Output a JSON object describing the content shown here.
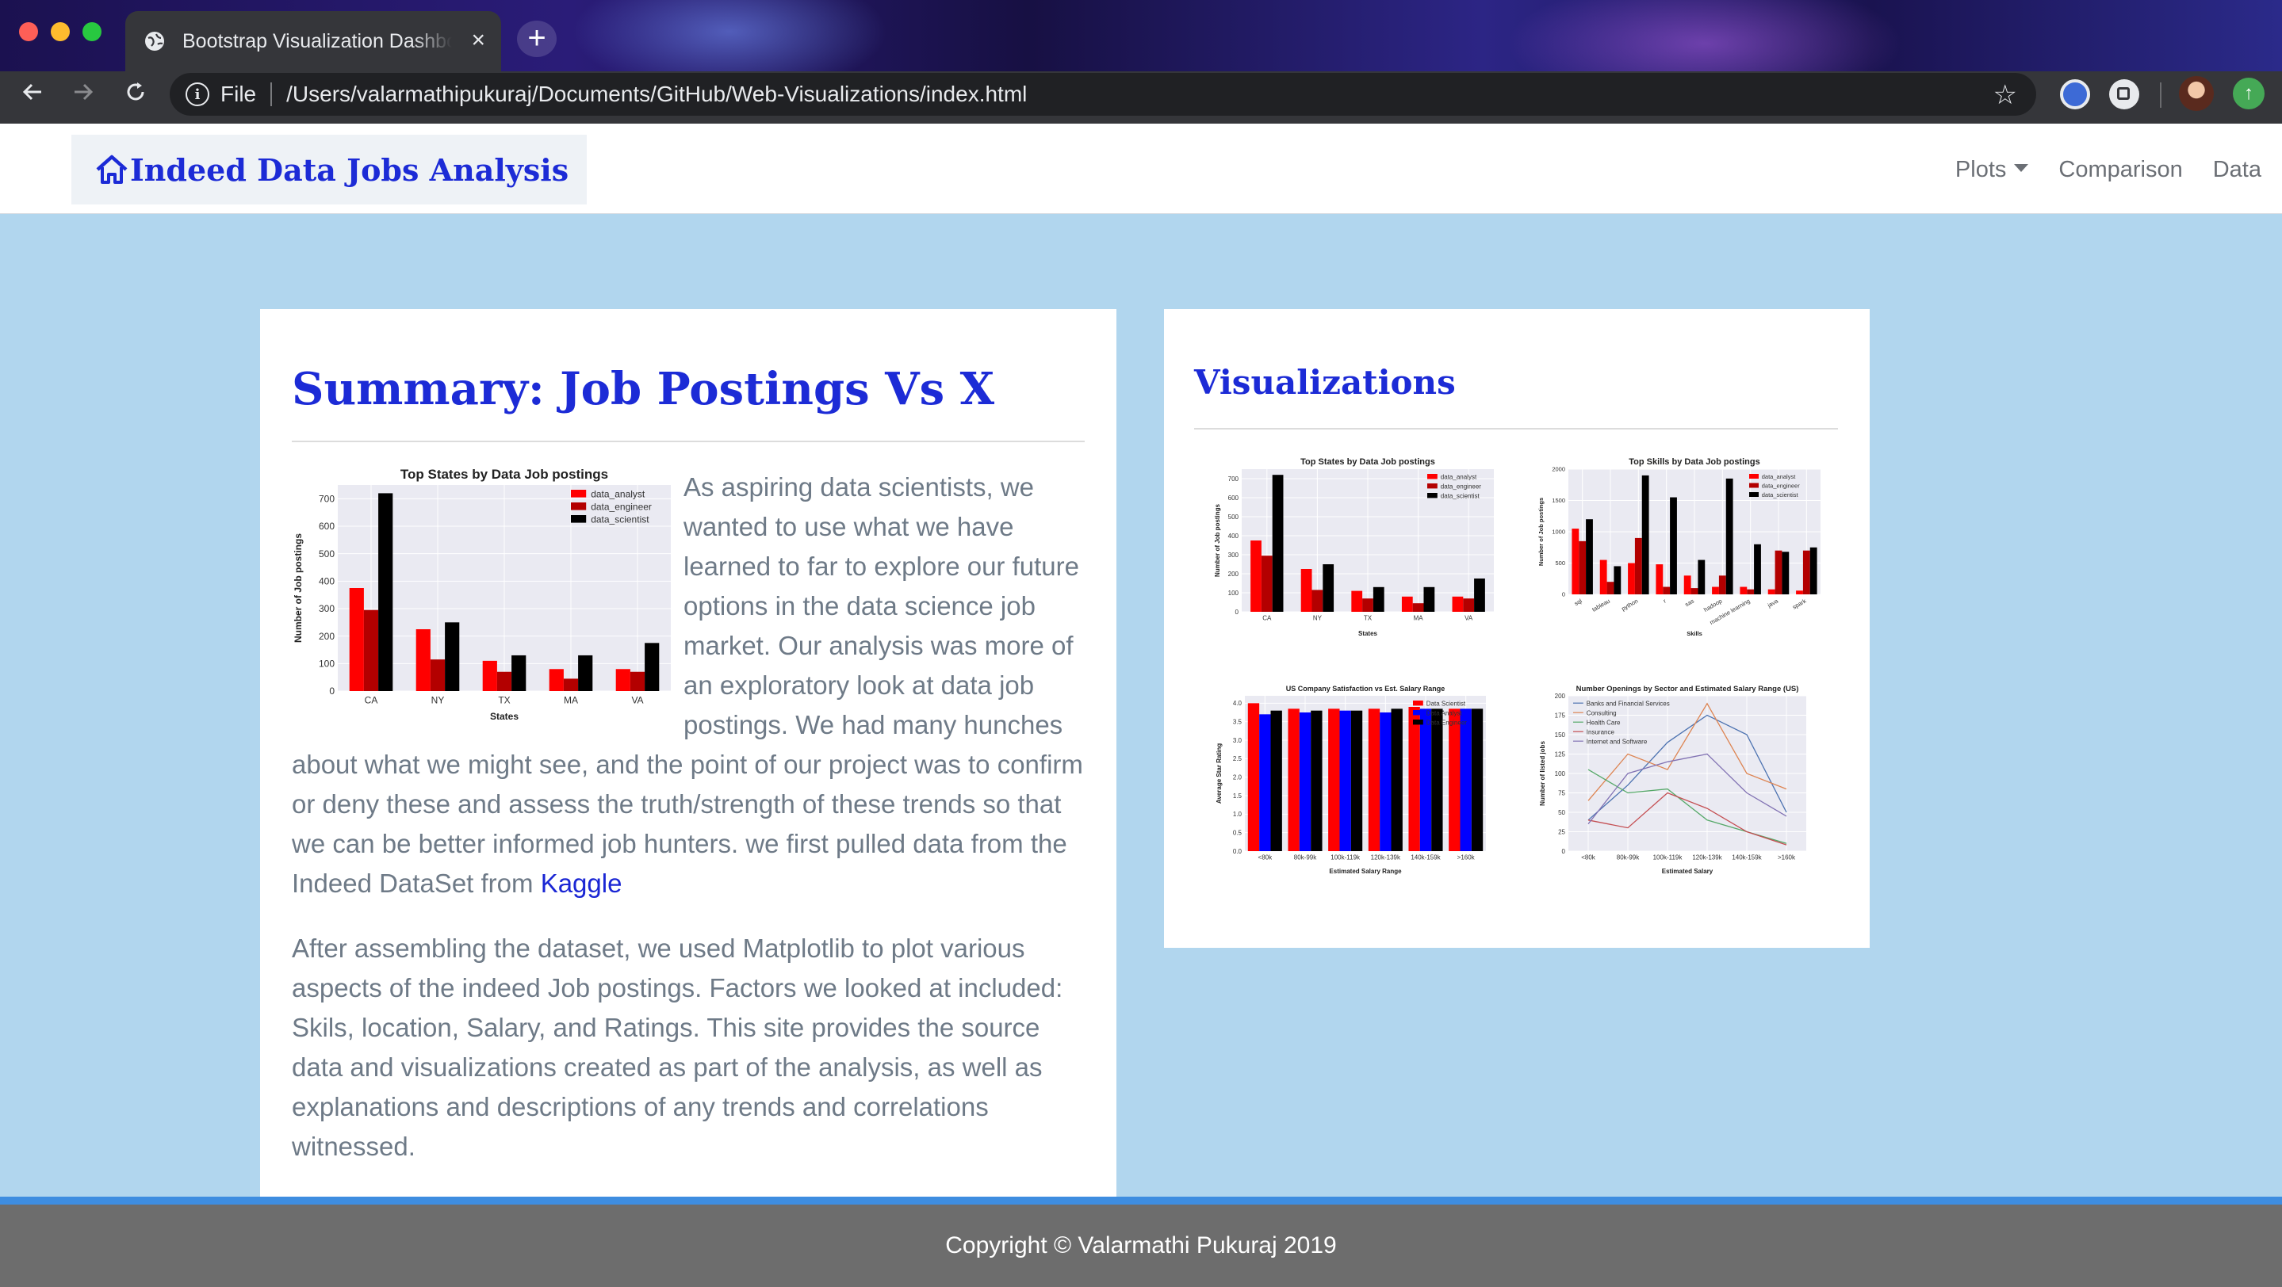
{
  "browser": {
    "tab_title": "Bootstrap Visualization Dashboard",
    "close_glyph": "×",
    "new_tab_glyph": "+",
    "scheme_label": "File",
    "url": "/Users/valarmathipukuraj/Documents/GitHub/Web-Visualizations/index.html",
    "icons": [
      "globe-icon",
      "back-arrow-icon",
      "forward-arrow-icon",
      "reload-icon",
      "info-icon",
      "star-icon",
      "extension-icon",
      "avatar",
      "update-icon"
    ]
  },
  "navbar": {
    "brand": "Indeed Data Jobs Analysis",
    "brand_icon": "home-icon",
    "links": [
      "Plots",
      "Comparison",
      "Data"
    ]
  },
  "summary": {
    "title": "Summary: Job Postings Vs X",
    "p1": "As aspiring data scientists, we wanted to use what we have learned to far to explore our future options in the data science job market. Our analysis was more of an exploratory look at data job postings. We had many hunches about what we might see, and the point of our project was to confirm or deny these and assess the truth/strength of these trends so that we can be better informed job hunters. we first pulled data from the Indeed DataSet from",
    "link": "Kaggle",
    "p2": "After assembling the dataset, we used Matplotlib to plot various aspects of the indeed Job postings. Factors we looked at included: Skils, location, Salary, and Ratings. This site provides the source data and visualizations created as part of the analysis, as well as explanations and descriptions of any trends and correlations witnessed."
  },
  "visualizations": {
    "title": "Visualizations"
  },
  "footer": {
    "text": "Copyright © Valarmathi Pukuraj 2019"
  },
  "colors": {
    "accent": "#1c2bd6",
    "page_bg": "#b1d6ee",
    "footer_bg": "#6d6d6d",
    "footer_accent": "#3e8de0"
  },
  "chart_data": [
    {
      "type": "bar",
      "title": "Top States by Data Job postings",
      "xlabel": "States",
      "ylabel": "Number of Job postings",
      "categories": [
        "CA",
        "NY",
        "TX",
        "MA",
        "VA"
      ],
      "ylim": [
        0,
        750
      ],
      "yticks": [
        0,
        100,
        200,
        300,
        400,
        500,
        600,
        700
      ],
      "series": [
        {
          "name": "data_analyst",
          "color": "#ff0000",
          "values": [
            375,
            225,
            110,
            80,
            80
          ]
        },
        {
          "name": "data_engineer",
          "color": "#b30000",
          "values": [
            295,
            115,
            70,
            45,
            70
          ]
        },
        {
          "name": "data_scientist",
          "color": "#000000",
          "values": [
            720,
            250,
            130,
            130,
            175
          ]
        }
      ],
      "legend": "top-right",
      "grid": true
    },
    {
      "type": "bar",
      "title": "Top States by Data Job postings",
      "xlabel": "States",
      "ylabel": "Number of Job postings",
      "categories": [
        "CA",
        "NY",
        "TX",
        "MA",
        "VA"
      ],
      "ylim": [
        0,
        750
      ],
      "yticks": [
        0,
        100,
        200,
        300,
        400,
        500,
        600,
        700
      ],
      "series": [
        {
          "name": "data_analyst",
          "color": "#ff0000",
          "values": [
            375,
            225,
            110,
            80,
            80
          ]
        },
        {
          "name": "data_engineer",
          "color": "#b30000",
          "values": [
            295,
            115,
            70,
            45,
            70
          ]
        },
        {
          "name": "data_scientist",
          "color": "#000000",
          "values": [
            720,
            250,
            130,
            130,
            175
          ]
        }
      ],
      "legend": "top-right",
      "grid": true
    },
    {
      "type": "bar",
      "title": "Top Skills by Data Job postings",
      "xlabel": "Skills",
      "ylabel": "Number of Job postings",
      "categories": [
        "sql",
        "tableau",
        "python",
        "r",
        "sas",
        "hadoop",
        "machine learning",
        "java",
        "spark"
      ],
      "ylim": [
        0,
        2000
      ],
      "yticks": [
        0,
        500,
        1000,
        1500,
        2000
      ],
      "series": [
        {
          "name": "data_analyst",
          "color": "#ff0000",
          "values": [
            1050,
            550,
            500,
            480,
            300,
            120,
            120,
            80,
            60
          ]
        },
        {
          "name": "data_engineer",
          "color": "#b30000",
          "values": [
            850,
            200,
            900,
            120,
            100,
            300,
            80,
            700,
            700
          ]
        },
        {
          "name": "data_scientist",
          "color": "#000000",
          "values": [
            1200,
            450,
            1900,
            1550,
            550,
            1850,
            800,
            680,
            750
          ]
        }
      ],
      "legend": "top-right",
      "grid": true
    },
    {
      "type": "bar",
      "title": "US Company Satisfaction vs Est. Salary Range",
      "xlabel": "Estimated Salary Range",
      "ylabel": "Average Star Rating",
      "categories": [
        "<80k",
        "80k-99k",
        "100k-119k",
        "120k-139k",
        "140k-159k",
        ">160k"
      ],
      "ylim": [
        0,
        4.2
      ],
      "yticks": [
        0.0,
        0.5,
        1.0,
        1.5,
        2.0,
        2.5,
        3.0,
        3.5,
        4.0
      ],
      "series": [
        {
          "name": "Data Scientist",
          "color": "#ff0000",
          "values": [
            4.0,
            3.85,
            3.85,
            3.85,
            3.9,
            3.85
          ]
        },
        {
          "name": "Data Analyst",
          "color": "#0000ff",
          "values": [
            3.7,
            3.75,
            3.8,
            3.75,
            3.85,
            3.85
          ]
        },
        {
          "name": "Data Engineer",
          "color": "#000000",
          "values": [
            3.8,
            3.8,
            3.8,
            3.85,
            3.85,
            3.85
          ]
        }
      ],
      "legend": "top-right",
      "grid": true
    },
    {
      "type": "line",
      "title": "Number Openings by Sector and Estimated Salary Range (US)",
      "xlabel": "Estimated Salary",
      "ylabel": "Number of listed jobs",
      "categories": [
        "<80k",
        "80k-99k",
        "100k-119k",
        "120k-139k",
        "140k-159k",
        ">160k"
      ],
      "ylim": [
        0,
        200
      ],
      "yticks": [
        0,
        25,
        50,
        75,
        100,
        125,
        150,
        175,
        200
      ],
      "series": [
        {
          "name": "Banks and Financial Services",
          "color": "#4c72b0",
          "values": [
            40,
            85,
            140,
            175,
            150,
            50
          ]
        },
        {
          "name": "Consulting",
          "color": "#dd8452",
          "values": [
            65,
            125,
            105,
            190,
            100,
            80
          ]
        },
        {
          "name": "Health Care",
          "color": "#55a868",
          "values": [
            105,
            75,
            80,
            40,
            25,
            10
          ]
        },
        {
          "name": "Insurance",
          "color": "#c44e52",
          "values": [
            40,
            30,
            75,
            55,
            25,
            8
          ]
        },
        {
          "name": "Internet and Software",
          "color": "#8172b3",
          "values": [
            35,
            100,
            115,
            125,
            75,
            45
          ]
        }
      ],
      "legend": "top-left",
      "grid": true
    }
  ]
}
